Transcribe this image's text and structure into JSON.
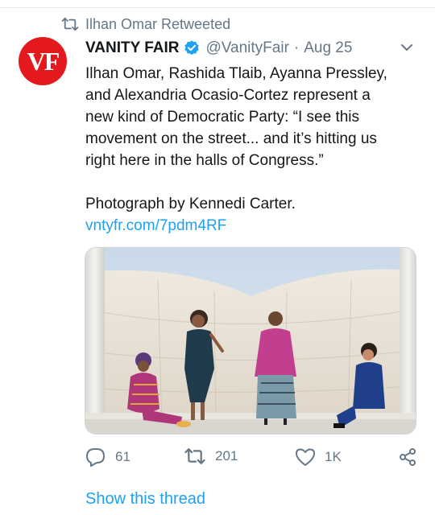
{
  "retweet_context": {
    "text": "Ilhan Omar Retweeted",
    "icon": "retweet-icon"
  },
  "author": {
    "avatar_text": "VF",
    "avatar_color": "#e3191e",
    "name": "VANITY FAIR",
    "verified": true,
    "handle": "@VanityFair",
    "separator": "·",
    "date": "Aug 25"
  },
  "tweet": {
    "lines": [
      "Ilhan Omar, Rashida Tlaib, Ayanna Pressley,",
      "and Alexandria Ocasio-Cortez represent a",
      "new kind of Democratic Party: “I see this",
      "movement on the street... and it’s hitting us",
      "right here in the halls of Congress.”"
    ],
    "credit": "Photograph by Kennedi Carter.",
    "link": "vntyfr.com/7pdm4RF"
  },
  "actions": {
    "reply_count": "61",
    "retweet_count": "201",
    "like_count": "1K"
  },
  "show_thread": "Show this thread",
  "colors": {
    "accent": "#1da1f2",
    "secondary_text": "#657786",
    "primary_text": "#14171a"
  }
}
